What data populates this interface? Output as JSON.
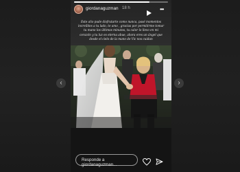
{
  "story": {
    "username": "giordanaguzman",
    "time": "18 h",
    "progress": 0.8,
    "caption": "Este año pude disfrutarte como nunca, pasé momentos increíbles a tu lado, te amo , gracias por permitirme tomar tu mano los últimos minutos, tu calor lo llevo en mi corazón y tu luz es eterna abue, ahora eres un ángel que desde el cielo de la mano de Vic nos cuidan",
    "reply_placeholder": "Responde a giordanaguzman..."
  },
  "icons": {
    "prev": "chevron-left-icon",
    "next": "chevron-right-icon",
    "play": "play-icon",
    "more": "more-icon",
    "heart": "heart-icon",
    "send": "send-icon"
  }
}
